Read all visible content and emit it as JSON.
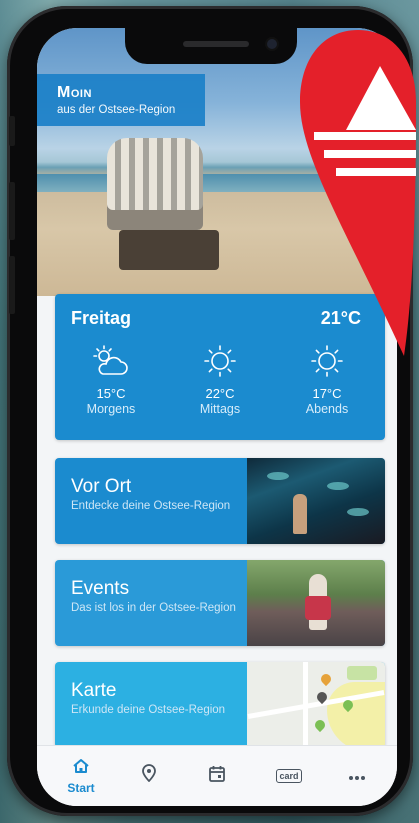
{
  "greeting": {
    "title": "Moin",
    "subtitle": "aus der Ostsee-Region"
  },
  "weather": {
    "day": "Freitag",
    "current_temp": "21°C",
    "periods": [
      {
        "temp": "15°C",
        "label": "Morgens",
        "icon": "partly-cloudy-icon"
      },
      {
        "temp": "22°C",
        "label": "Mittags",
        "icon": "sun-icon"
      },
      {
        "temp": "17°C",
        "label": "Abends",
        "icon": "sun-icon"
      }
    ]
  },
  "cards": [
    {
      "title": "Vor Ort",
      "subtitle": "Entdecke deine Ostsee-Region",
      "color": "#1b8bcf"
    },
    {
      "title": "Events",
      "subtitle": "Das ist los in der Ostsee-Region",
      "color": "#2a9ad8"
    },
    {
      "title": "Karte",
      "subtitle": "Erkunde deine Ostsee-Region",
      "color": "#2cb0e2"
    }
  ],
  "tabbar": {
    "start_label": "Start",
    "card_icon_text": "card",
    "icons": [
      "home-icon",
      "location-pin-icon",
      "calendar-icon",
      "card-icon",
      "more-icon"
    ]
  },
  "colors": {
    "accent": "#1b8bcf",
    "marker_red": "#e4202a"
  }
}
